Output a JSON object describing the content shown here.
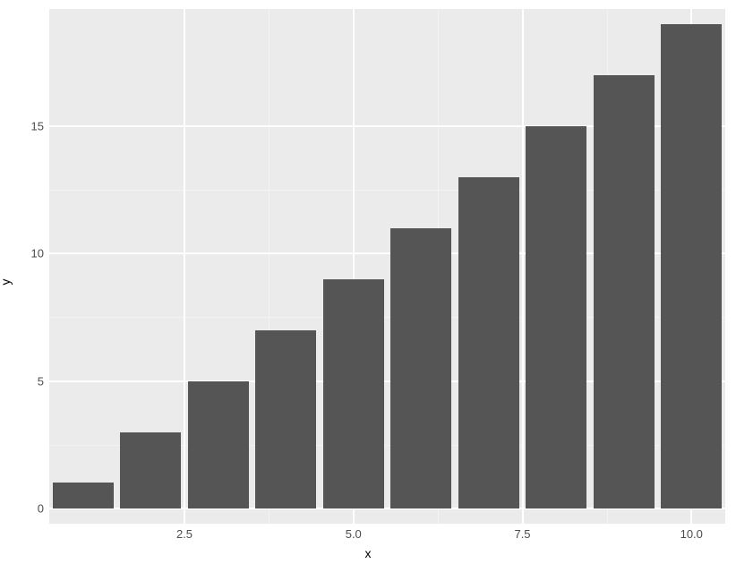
{
  "chart_data": {
    "type": "bar",
    "categories": [
      1,
      2,
      3,
      4,
      5,
      6,
      7,
      8,
      9,
      10
    ],
    "values": [
      1,
      3,
      5,
      7,
      9,
      11,
      13,
      15,
      17,
      19
    ],
    "title": "",
    "xlabel": "x",
    "ylabel": "y",
    "x_ticks": [
      2.5,
      5.0,
      7.5,
      10.0
    ],
    "x_tick_labels": [
      "2.5",
      "5.0",
      "7.5",
      "10.0"
    ],
    "y_ticks": [
      0,
      5,
      10,
      15
    ],
    "y_tick_labels": [
      "0",
      "5",
      "10",
      "15"
    ],
    "xlim": [
      0.5,
      10.5
    ],
    "ylim": [
      -0.6,
      19.6
    ],
    "bar_width": 0.9,
    "bar_fill": "#555555",
    "panel_bg": "#ebebeb"
  }
}
